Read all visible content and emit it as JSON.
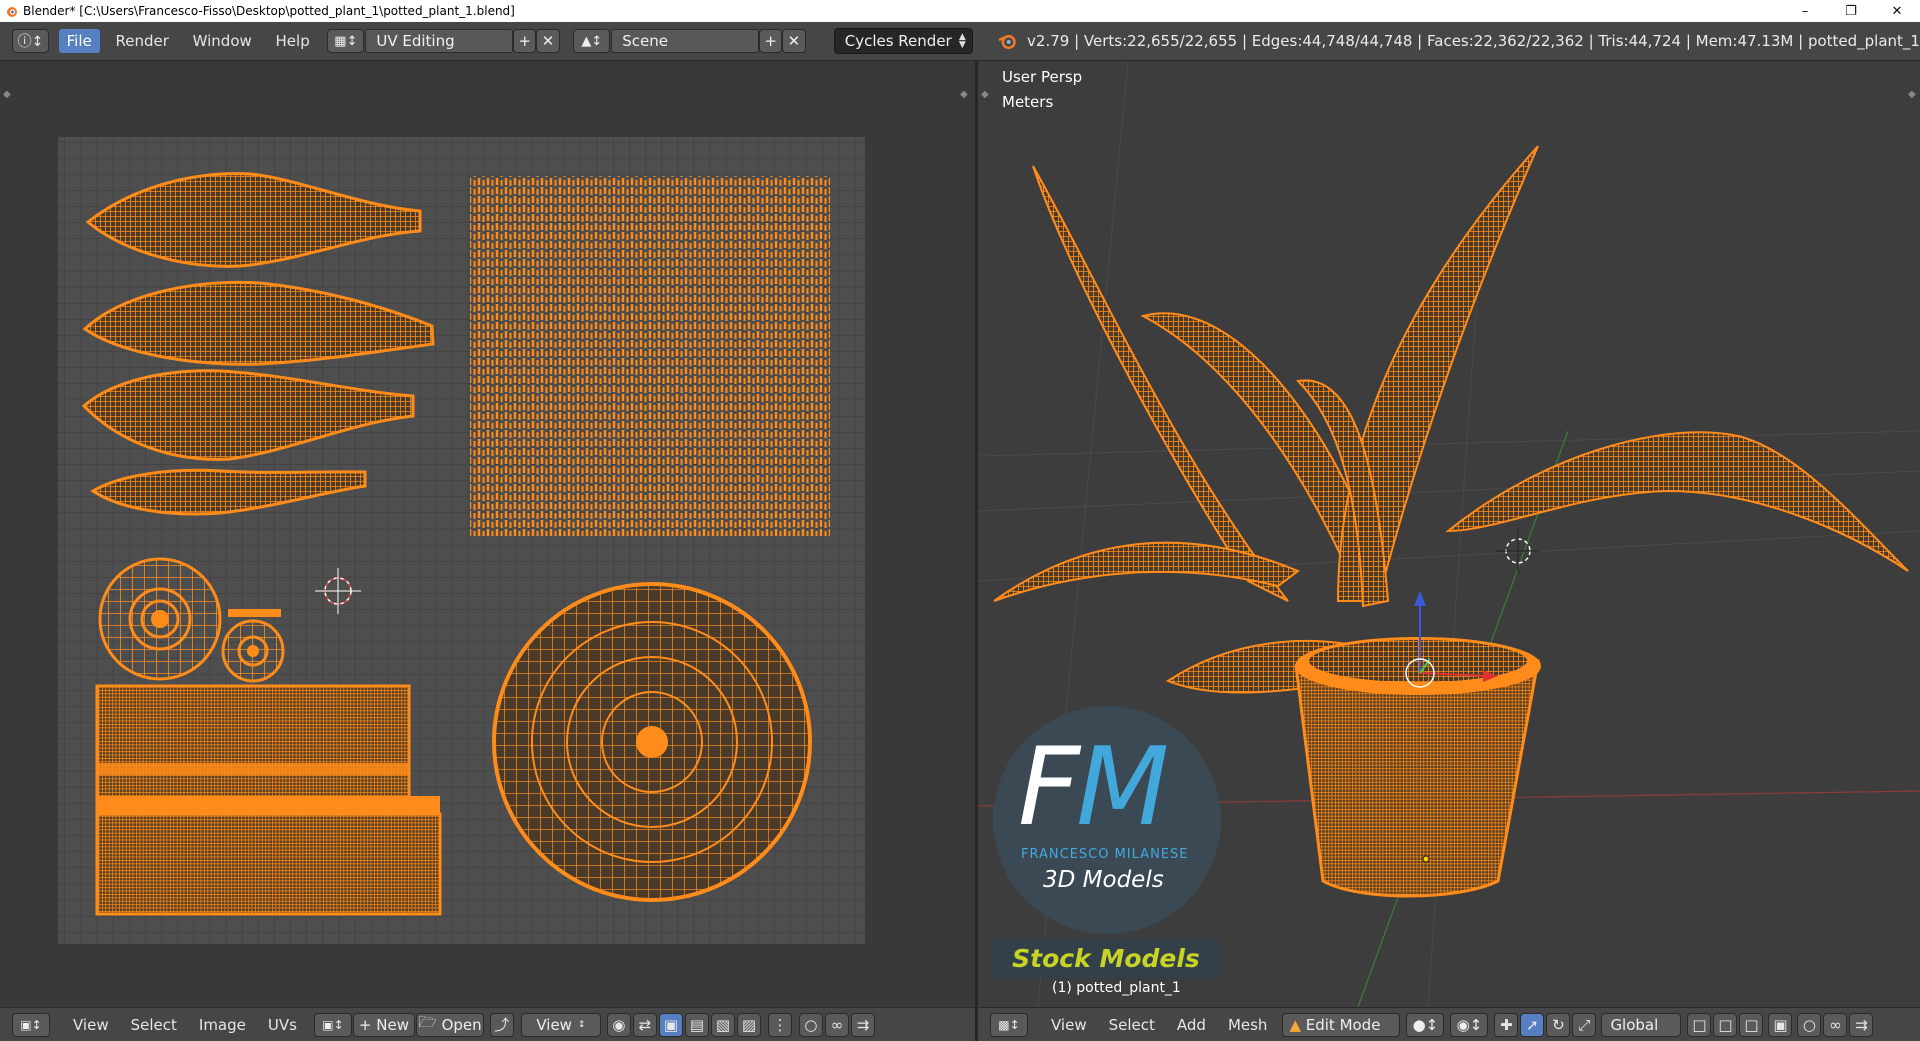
{
  "window": {
    "title": "Blender* [C:\\Users\\Francesco-Fisso\\Desktop\\potted_plant_1\\potted_plant_1.blend]",
    "controls": [
      "minimize",
      "restore",
      "close"
    ]
  },
  "header": {
    "menus": [
      "File",
      "Render",
      "Window",
      "Help"
    ],
    "screen_layout": "UV Editing",
    "scene": "Scene",
    "render_engine": "Cycles Render",
    "stats": "v2.79 | Verts:22,655/22,655 | Edges:44,748/44,748 | Faces:22,362/22,362 | Tris:44,724 | Mem:47.13M | potted_plant_1"
  },
  "viewport": {
    "view_name": "User Persp",
    "units": "Meters",
    "object_label": "(1) potted_plant_1"
  },
  "watermark": {
    "logo": "FM",
    "name": "FRANCESCO MILANESE",
    "subtitle": "3D Models",
    "banner": "Stock Models"
  },
  "uv_footer": {
    "items": [
      "View",
      "Select",
      "Image",
      "UVs"
    ],
    "new_label": "New",
    "open_label": "Open",
    "view_label": "View"
  },
  "vp_footer": {
    "items": [
      "View",
      "Select",
      "Add",
      "Mesh"
    ],
    "mode": "Edit Mode",
    "orientation": "Global"
  },
  "colors": {
    "accent": "#5680c2",
    "mesh": "#ff8c1a",
    "bg": "#393939"
  }
}
